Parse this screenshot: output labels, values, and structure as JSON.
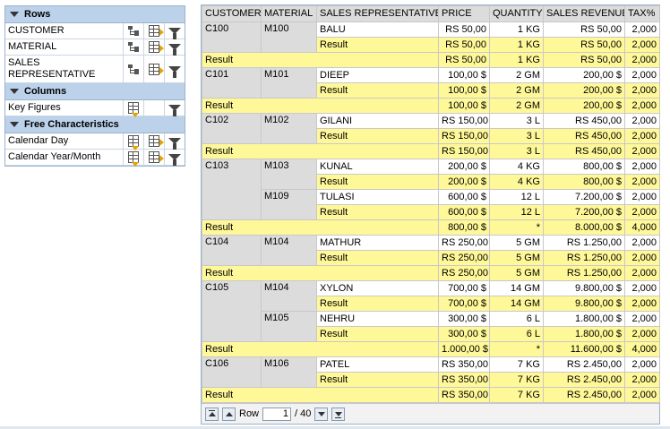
{
  "nav": {
    "rows_header": "Rows",
    "rows": [
      "CUSTOMER",
      "MATERIAL",
      "SALES REPRESENTATIVE"
    ],
    "columns_header": "Columns",
    "columns": [
      "Key Figures"
    ],
    "free_header": "Free Characteristics",
    "free": [
      "Calendar Day",
      "Calendar Year/Month"
    ]
  },
  "table": {
    "headers": [
      "CUSTOMER",
      "MATERIAL",
      "SALES REPRESENTATIVE",
      "PRICE",
      "QUANTITY",
      "SALES REVENUE",
      "TAX%"
    ],
    "result_label": "Result",
    "rows": [
      {
        "t": "d",
        "cust": "C100",
        "mat": "M100",
        "rep": "BALU",
        "p": "RS 50,00",
        "q": "1 KG",
        "r": "RS 50,00",
        "x": "2,000"
      },
      {
        "t": "mr",
        "p": "RS 50,00",
        "q": "1 KG",
        "r": "RS 50,00",
        "x": "2,000"
      },
      {
        "t": "cr",
        "p": "RS 50,00",
        "q": "1 KG",
        "r": "RS 50,00",
        "x": "2,000"
      },
      {
        "t": "d",
        "cust": "C101",
        "mat": "M101",
        "rep": "DIEEP",
        "p": "100,00 $",
        "q": "2 GM",
        "r": "200,00 $",
        "x": "2,000"
      },
      {
        "t": "mr",
        "p": "100,00 $",
        "q": "2 GM",
        "r": "200,00 $",
        "x": "2,000"
      },
      {
        "t": "cr",
        "p": "100,00 $",
        "q": "2 GM",
        "r": "200,00 $",
        "x": "2,000"
      },
      {
        "t": "d",
        "cust": "C102",
        "mat": "M102",
        "rep": "GILANI",
        "p": "RS 150,00",
        "q": "3 L",
        "r": "RS 450,00",
        "x": "2,000"
      },
      {
        "t": "mr",
        "p": "RS 150,00",
        "q": "3 L",
        "r": "RS 450,00",
        "x": "2,000"
      },
      {
        "t": "cr",
        "p": "RS 150,00",
        "q": "3 L",
        "r": "RS 450,00",
        "x": "2,000"
      },
      {
        "t": "d",
        "cust": "C103",
        "mat": "M103",
        "rep": "KUNAL",
        "p": "200,00 $",
        "q": "4 KG",
        "r": "800,00 $",
        "x": "2,000"
      },
      {
        "t": "mr",
        "p": "200,00 $",
        "q": "4 KG",
        "r": "800,00 $",
        "x": "2,000"
      },
      {
        "t": "d",
        "mat": "M109",
        "rep": "TULASI",
        "p": "600,00 $",
        "q": "12 L",
        "r": "7.200,00 $",
        "x": "2,000"
      },
      {
        "t": "mr",
        "p": "600,00 $",
        "q": "12 L",
        "r": "7.200,00 $",
        "x": "2,000"
      },
      {
        "t": "cr",
        "p": "800,00 $",
        "q": "*",
        "r": "8.000,00 $",
        "x": "4,000"
      },
      {
        "t": "d",
        "cust": "C104",
        "mat": "M104",
        "rep": "MATHUR",
        "p": "RS 250,00",
        "q": "5 GM",
        "r": "RS 1.250,00",
        "x": "2,000"
      },
      {
        "t": "mr",
        "p": "RS 250,00",
        "q": "5 GM",
        "r": "RS 1.250,00",
        "x": "2,000"
      },
      {
        "t": "cr",
        "p": "RS 250,00",
        "q": "5 GM",
        "r": "RS 1.250,00",
        "x": "2,000"
      },
      {
        "t": "d",
        "cust": "C105",
        "mat": "M104",
        "rep": "XYLON",
        "p": "700,00 $",
        "q": "14 GM",
        "r": "9.800,00 $",
        "x": "2,000"
      },
      {
        "t": "mr",
        "p": "700,00 $",
        "q": "14 GM",
        "r": "9.800,00 $",
        "x": "2,000"
      },
      {
        "t": "d",
        "mat": "M105",
        "rep": "NEHRU",
        "p": "300,00 $",
        "q": "6 L",
        "r": "1.800,00 $",
        "x": "2,000"
      },
      {
        "t": "mr",
        "p": "300,00 $",
        "q": "6 L",
        "r": "1.800,00 $",
        "x": "2,000"
      },
      {
        "t": "cr",
        "p": "1.000,00 $",
        "q": "*",
        "r": "11.600,00 $",
        "x": "4,000"
      },
      {
        "t": "d",
        "cust": "C106",
        "mat": "M106",
        "rep": "PATEL",
        "p": "RS 350,00",
        "q": "7 KG",
        "r": "RS 2.450,00",
        "x": "2,000"
      },
      {
        "t": "mr",
        "p": "RS 350,00",
        "q": "7 KG",
        "r": "RS 2.450,00",
        "x": "2,000"
      },
      {
        "t": "cr",
        "p": "RS 350,00",
        "q": "7 KG",
        "r": "RS 2.450,00",
        "x": "2,000"
      }
    ]
  },
  "pager": {
    "row_label": "Row",
    "current": "1",
    "total": "/ 40"
  }
}
